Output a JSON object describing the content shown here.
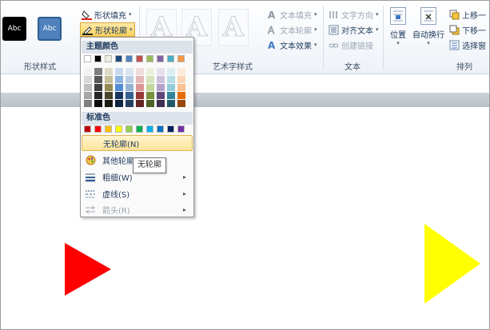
{
  "ribbon": {
    "shape_styles_label": "形状样式",
    "wordart_styles_label": "艺术字样式",
    "text_label": "文本",
    "arrange_label": "排列",
    "style_swatch_1": "Abc",
    "style_swatch_2": "Abc",
    "shape_fill": "形状填充",
    "shape_outline": "形状轮廓",
    "text_fill": "文本填充",
    "text_outline": "文本轮廓",
    "text_effects": "文本效果",
    "text_direction": "文字方向",
    "align_text": "对齐文本",
    "create_link": "创建链接",
    "position": "位置",
    "wrap_text": "自动换行",
    "bring_forward": "上移一",
    "send_backward": "下移一",
    "selection_pane": "选择窗",
    "wordart_letter": "A"
  },
  "menu": {
    "theme_colors_title": "主题颜色",
    "standard_colors_title": "标准色",
    "no_outline": "无轮廓(N)",
    "more_colors": "其他轮廓",
    "weight": "粗细(W)",
    "dashes": "虚线(S)",
    "arrows": "箭头(R)",
    "tooltip": "无轮廓",
    "theme_top_row": [
      "#ffffff",
      "#000000",
      "#eeece1",
      "#1f497d",
      "#4f81bd",
      "#c0504d",
      "#9bbb59",
      "#8064a2",
      "#4bacc6",
      "#f79646"
    ],
    "theme_shades": [
      [
        "#f2f2f2",
        "#7f7f7f",
        "#ddd9c3",
        "#c6d9f0",
        "#dbe5f1",
        "#f2dcdb",
        "#ebf1dd",
        "#e5e0ec",
        "#dbeef3",
        "#fdeada"
      ],
      [
        "#d8d8d8",
        "#595959",
        "#c4bd97",
        "#8db3e2",
        "#b8cce4",
        "#e5b9b7",
        "#d7e3bc",
        "#ccc1d9",
        "#b7dde8",
        "#fbd5b5"
      ],
      [
        "#bfbfbf",
        "#3f3f3f",
        "#938953",
        "#548dd4",
        "#95b3d7",
        "#d99694",
        "#c3d69b",
        "#b2a2c7",
        "#92cddc",
        "#fac08f"
      ],
      [
        "#a5a5a5",
        "#262626",
        "#494429",
        "#17365d",
        "#366092",
        "#953734",
        "#76923c",
        "#5f497a",
        "#31859b",
        "#e36c09"
      ],
      [
        "#7f7f7f",
        "#0c0c0c",
        "#1d1b10",
        "#0f243e",
        "#244061",
        "#632423",
        "#4f6128",
        "#3f3151",
        "#205867",
        "#974806"
      ]
    ],
    "standard_colors": [
      "#c00000",
      "#ff0000",
      "#ffc000",
      "#ffff00",
      "#92d050",
      "#00b050",
      "#00b0f0",
      "#0070c0",
      "#002060",
      "#7030a0"
    ]
  },
  "shapes": {
    "red_triangle_color": "#ff0000",
    "yellow_triangle_color": "#ffff00"
  },
  "icons": [
    "paint-bucket-icon",
    "pen-outline-icon",
    "palette-icon",
    "line-weight-icon",
    "dash-icon",
    "arrow-style-icon"
  ]
}
